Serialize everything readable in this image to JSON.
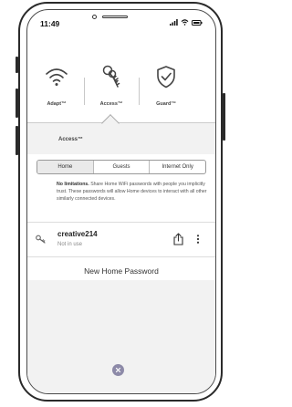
{
  "status_bar": {
    "time": "11:49",
    "icons": [
      "signal-icon",
      "wifi-icon",
      "battery-icon"
    ]
  },
  "nav": {
    "items": [
      {
        "label": "Adapt™",
        "icon": "wifi-icon"
      },
      {
        "label": "Access™",
        "icon": "keys-icon",
        "active": true
      },
      {
        "label": "Guard™",
        "icon": "shield-check-icon"
      }
    ]
  },
  "section": {
    "title": "Access™"
  },
  "tabs": [
    {
      "label": "Home",
      "active": true
    },
    {
      "label": "Guests",
      "active": false
    },
    {
      "label": "Internet Only",
      "active": false
    }
  ],
  "description": {
    "lead": "No limitations.",
    "body": "Share Home WiFi passwords with people you implicitly trust. These passwords will allow Home devices to interact with all other similarly connected devices."
  },
  "network": {
    "name": "creative214",
    "status": "Not in use",
    "icon": "key-icon",
    "actions": [
      "share-icon",
      "more-vertical-icon"
    ]
  },
  "new_password_label": "New Home Password",
  "close_icon": "close-icon",
  "colors": {
    "close_button": "#8d8aa8",
    "panel_bg": "#f2f2f2"
  }
}
